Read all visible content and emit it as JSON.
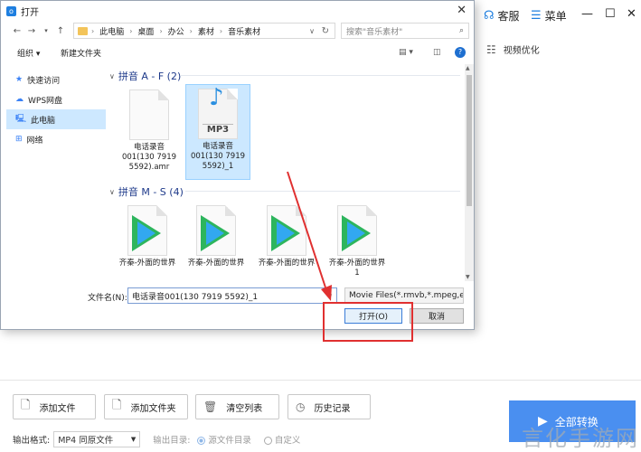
{
  "app": {
    "service": "客服",
    "menu": "菜单",
    "video_optimize": "视频优化",
    "buttons": {
      "add_file": "添加文件",
      "add_folder": "添加文件夹",
      "clear_list": "清空列表",
      "history": "历史记录",
      "convert_all": "全部转换"
    },
    "output_format_label": "输出格式:",
    "output_format_value": "MP4 同原文件",
    "output_dir_label": "输出目录:",
    "dir_source": "源文件目录",
    "dir_custom": "自定义",
    "watermark": "言化手游网"
  },
  "dialog": {
    "title": "打开",
    "close": "✕",
    "breadcrumb": [
      "此电脑",
      "桌面",
      "办公",
      "素材",
      "音乐素材"
    ],
    "search_placeholder": "搜索\"音乐素材\"",
    "toolbar": {
      "organize": "组织 ▾",
      "new_folder": "新建文件夹"
    },
    "nav": [
      {
        "label": "快速访问",
        "icon": "star-icon"
      },
      {
        "label": "WPS网盘",
        "icon": "cloud-icon"
      },
      {
        "label": "此电脑",
        "icon": "computer-icon"
      },
      {
        "label": "网络",
        "icon": "network-icon"
      }
    ],
    "groups": [
      {
        "title": "拼音 A - F (2)"
      },
      {
        "title": "拼音 M - S (4)"
      }
    ],
    "files_group1": [
      {
        "line1": "电话录音",
        "line2": "001(130 7919",
        "line3": "5592).amr"
      },
      {
        "line1": "电话录音",
        "line2": "001(130 7919",
        "line3": "5592)_1",
        "badge": "MP3"
      }
    ],
    "files_group2": [
      {
        "label": "齐秦-外面的世界",
        "extra": ""
      },
      {
        "label": "齐秦-外面的世界",
        "extra": ""
      },
      {
        "label": "齐秦-外面的世界",
        "extra": ""
      },
      {
        "label": "齐秦-外面的世界",
        "extra": "1"
      }
    ],
    "filename_label": "文件名(N):",
    "filename_value": "电话录音001(130 7919 5592)_1",
    "filetype_value": "Movie Files(*.rmvb,*.mpeg,et",
    "open": "打开(O)",
    "cancel": "取消"
  }
}
